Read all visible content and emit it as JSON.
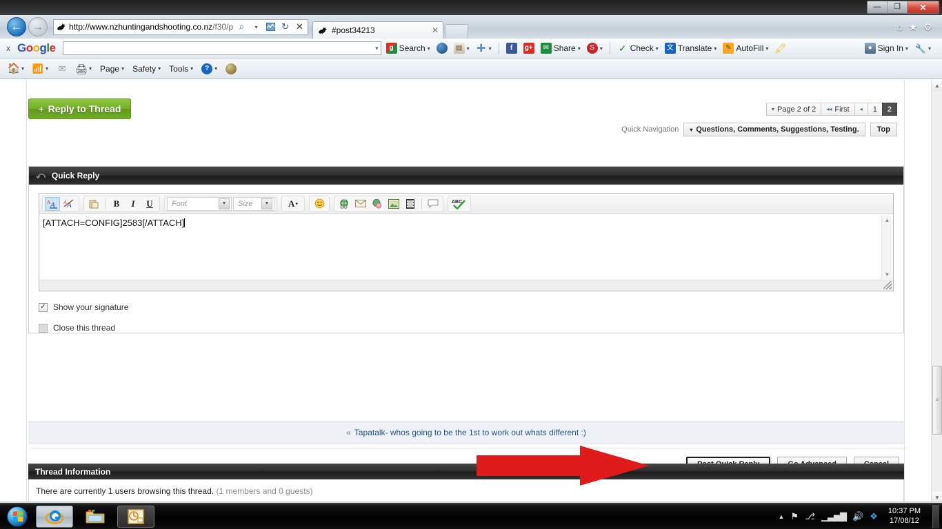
{
  "window": {
    "minimize_label": "—",
    "restore_label": "❐",
    "close_label": "✕"
  },
  "browser": {
    "back_label": "←",
    "forward_label": "→",
    "address": {
      "url_domain": "http://www.nzhuntingandshooting.co.nz",
      "url_path": "/f30/p‹",
      "search_icon": "⌕",
      "dropdown_icon": "▾",
      "compat_icon": "≋",
      "refresh_icon": "↻",
      "stop_icon": "✕"
    },
    "tab": {
      "title": "#post34213",
      "close_label": "✕"
    },
    "newtab_label": "",
    "right_icons": {
      "home": "⌂",
      "favorites": "★",
      "tools": "⚙"
    }
  },
  "google_toolbar": {
    "close_label": "x",
    "logo": [
      "G",
      "o",
      "o",
      "g",
      "l",
      "e"
    ],
    "search_value": "",
    "search_dropdown": "▾",
    "items": [
      {
        "label": "Search",
        "icon": "google-g-icon",
        "caret": "▾"
      },
      {
        "label": "",
        "icon": "globe-icon",
        "caret": ""
      },
      {
        "label": "",
        "icon": "news-icon",
        "caret": "▾"
      },
      {
        "label": "",
        "icon": "plus-icon",
        "caret": "▾"
      },
      {
        "label": "",
        "icon": "facebook-icon",
        "caret": ""
      },
      {
        "label": "",
        "icon": "google-plus-icon",
        "caret": ""
      },
      {
        "label": "Share",
        "icon": "share-icon",
        "caret": "▾"
      },
      {
        "label": "",
        "icon": "stumble-icon",
        "caret": "▾"
      },
      {
        "label": "Check",
        "icon": "spellcheck-icon",
        "caret": "▾"
      },
      {
        "label": "Translate",
        "icon": "translate-icon",
        "caret": "▾"
      },
      {
        "label": "AutoFill",
        "icon": "autofill-icon",
        "caret": "▾"
      },
      {
        "label": "",
        "icon": "highlighter-icon",
        "caret": ""
      }
    ],
    "sign_in": {
      "label": "Sign In",
      "caret": "▾"
    },
    "settings": {
      "icon": "wrench-icon",
      "caret": "▾"
    }
  },
  "command_bar": {
    "items": [
      {
        "label": "",
        "icon": "home-icon",
        "caret": "▾"
      },
      {
        "label": "",
        "icon": "feeds-icon",
        "caret": "▾"
      },
      {
        "label": "",
        "icon": "mail-icon",
        "caret": ""
      },
      {
        "label": "",
        "icon": "print-icon",
        "caret": "▾"
      },
      {
        "label": "Page",
        "icon": "",
        "caret": "▾"
      },
      {
        "label": "Safety",
        "icon": "",
        "caret": "▾"
      },
      {
        "label": "Tools",
        "icon": "",
        "caret": "▾"
      },
      {
        "label": "",
        "icon": "help-icon",
        "caret": "▾"
      },
      {
        "label": "",
        "icon": "smartscreen-icon",
        "caret": ""
      }
    ]
  },
  "forum": {
    "reply_button": {
      "plus": "+",
      "label": "Reply to Thread"
    },
    "pagination": {
      "page_label": "Page 2 of 2",
      "page_caret": "▾",
      "first_label": "First",
      "first_icon": "◂◂",
      "prev_icon": "◂",
      "pages": [
        "1",
        "2"
      ],
      "current_page": "2"
    },
    "quick_navigation": {
      "label": "Quick Navigation",
      "selected": "Questions, Comments, Suggestions, Testing.",
      "caret": "▾",
      "top_label": "Top"
    },
    "quick_reply": {
      "header": "Quick Reply",
      "header_icon": "reply-arrow-icon",
      "toolbar": {
        "group1": [
          {
            "name": "wysiwyg-mode-button",
            "glyph": "A̲A",
            "active": true
          },
          {
            "name": "source-mode-button",
            "glyph": "A̶A",
            "active": false
          }
        ],
        "group2": [
          {
            "name": "paste-button",
            "glyph": "⎘",
            "active": false
          },
          {
            "name": "bold-button",
            "glyph": "B",
            "active": false
          },
          {
            "name": "italic-button",
            "glyph": "I",
            "active": false
          },
          {
            "name": "underline-button",
            "glyph": "U",
            "active": false
          }
        ],
        "font_placeholder": "Font",
        "size_placeholder": "Size",
        "group3": [
          {
            "name": "font-color-button",
            "glyph": "A",
            "caret": "▾"
          }
        ],
        "group4": [
          {
            "name": "smilie-button",
            "glyph": "☺"
          }
        ],
        "group5": [
          {
            "name": "insert-link-button",
            "glyph": "ἱ0"
          },
          {
            "name": "insert-email-button",
            "glyph": "✉"
          },
          {
            "name": "remove-link-button",
            "glyph": "◑"
          },
          {
            "name": "insert-image-button",
            "glyph": "⬚"
          },
          {
            "name": "insert-video-button",
            "glyph": "‖"
          },
          {
            "name": "wrap-quote-button",
            "glyph": "▢"
          }
        ],
        "group6": [
          {
            "name": "spellcheck-button",
            "glyph": "ABC✓"
          }
        ]
      },
      "textarea_value": "[ATTACH=CONFIG]2583[/ATTACH]",
      "scroll_up": "▲",
      "scroll_down": "▼",
      "options": [
        {
          "label": "Show your signature",
          "checked": true,
          "check_glyph": "✓"
        },
        {
          "label": "Close this thread",
          "checked": false,
          "check_glyph": ""
        }
      ],
      "buttons": [
        {
          "label": "Post Quick Reply",
          "primary": true
        },
        {
          "label": "Go Advanced",
          "primary": false
        },
        {
          "label": "Cancel",
          "primary": false
        }
      ]
    },
    "footer_nav": {
      "chevron": "«",
      "link": "Tapatalk- whos going to be the 1st to work out whats different :)"
    },
    "thread_information": {
      "header": "Thread Information",
      "text": "There are currently 1 users browsing this thread.",
      "muted": "(1 members and 0 guests)"
    }
  },
  "annotation": {
    "arrow_color": "#e01b1b",
    "arrow_name": "red-arrow-pointing-to-post-quick-reply"
  },
  "scrollbar": {
    "up_arrow": "▲",
    "down_arrow": "▼",
    "grip": "≡"
  },
  "taskbar": {
    "start_label": "Start",
    "buttons": [
      {
        "name": "taskbar-internet-explorer",
        "glyph": "e"
      },
      {
        "name": "taskbar-windows-explorer",
        "glyph": "Ὄ1"
      },
      {
        "name": "taskbar-powerpoint",
        "glyph": "◷"
      }
    ],
    "tray": {
      "show_hidden": "▲",
      "icons": [
        {
          "name": "action-center-flag-icon",
          "glyph": "⚑"
        },
        {
          "name": "network-plug-icon",
          "glyph": "⎇"
        },
        {
          "name": "signal-bars-icon",
          "glyph": "▁▃▅▇"
        },
        {
          "name": "volume-icon",
          "glyph": "ὐa"
        },
        {
          "name": "dropbox-icon",
          "glyph": "❖"
        }
      ],
      "time": "10:37 PM",
      "date": "17/08/12"
    }
  }
}
